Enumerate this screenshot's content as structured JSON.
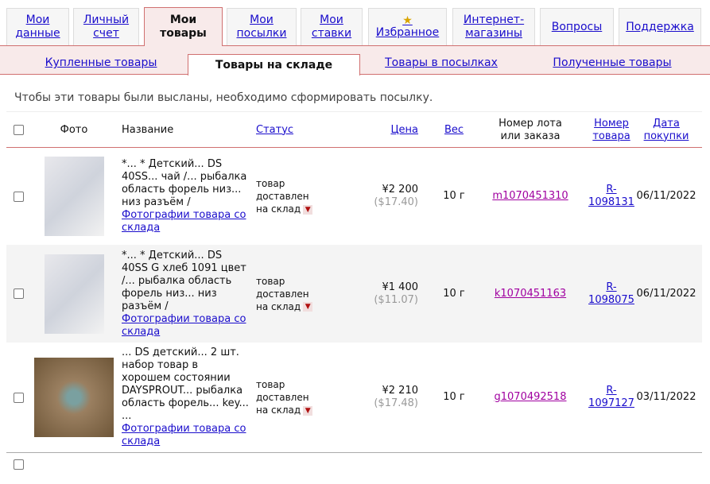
{
  "tabs": [
    {
      "label": "Мои данные",
      "l1": "Мои",
      "l2": "данные"
    },
    {
      "label": "Личный счет",
      "l1": "Личный",
      "l2": "счет"
    },
    {
      "label": "Мои товары",
      "l1": "Мои",
      "l2": "товары",
      "active": true
    },
    {
      "label": "Мои посылки",
      "l1": "Мои",
      "l2": "посылки"
    },
    {
      "label": "Мои ставки",
      "l1": "Мои",
      "l2": "ставки"
    },
    {
      "label": "Избранное",
      "l1": "★",
      "l2": "Избранное"
    },
    {
      "label": "Интернет-магазины",
      "l1": "Интернет-",
      "l2": "магазины"
    },
    {
      "label": "Вопросы",
      "l1": "Вопросы",
      "l2": ""
    },
    {
      "label": "Поддержка",
      "l1": "Поддержка",
      "l2": ""
    }
  ],
  "subtabs": [
    "Купленные товары",
    "Товары на складе",
    "Товары в посылках",
    "Полученные товары"
  ],
  "note": "Чтобы эти товары были высланы, необходимо сформировать посылку.",
  "headers": {
    "photo": "Фото",
    "name": "Название",
    "status": "Статус",
    "price": "Цена",
    "weight": "Вес",
    "lot1": "Номер лота",
    "lot2": "или заказа",
    "num1": "Номер",
    "num2": "товара",
    "date1": "Дата",
    "date2": "покупки"
  },
  "photo_link": "Фотографии товара со склада",
  "rows": [
    {
      "name": "*... * Детский... DS 40SS... чай /... рыбалка область форель низ... низ разъём /",
      "s1": "товар",
      "s2": "доставлен",
      "s3": "на склад",
      "price": "¥2 200",
      "usd": "($17.40)",
      "weight": "10 г",
      "lot": "m1070451310",
      "num1": "R-",
      "num2": "1098131",
      "date": "06/11/2022"
    },
    {
      "name": "*... * Детский... DS 40SS G хлеб 1091 цвет /... рыбалка область форель низ... низ разъём /",
      "s1": "товар",
      "s2": "доставлен",
      "s3": "на склад",
      "price": "¥1 400",
      "usd": "($11.07)",
      "weight": "10 г",
      "lot": "k1070451163",
      "num1": "R-",
      "num2": "1098075",
      "date": "06/11/2022"
    },
    {
      "name": "... DS детский... 2 шт. набор товар в хорошем состоянии DAYSPROUT... рыбалка область форель... key... ...",
      "s1": "товар",
      "s2": "доставлен",
      "s3": "на склад",
      "price": "¥2 210",
      "usd": "($17.48)",
      "weight": "10 г",
      "lot": "g1070492518",
      "num1": "R-",
      "num2": "1097127",
      "date": "03/11/2022"
    }
  ]
}
